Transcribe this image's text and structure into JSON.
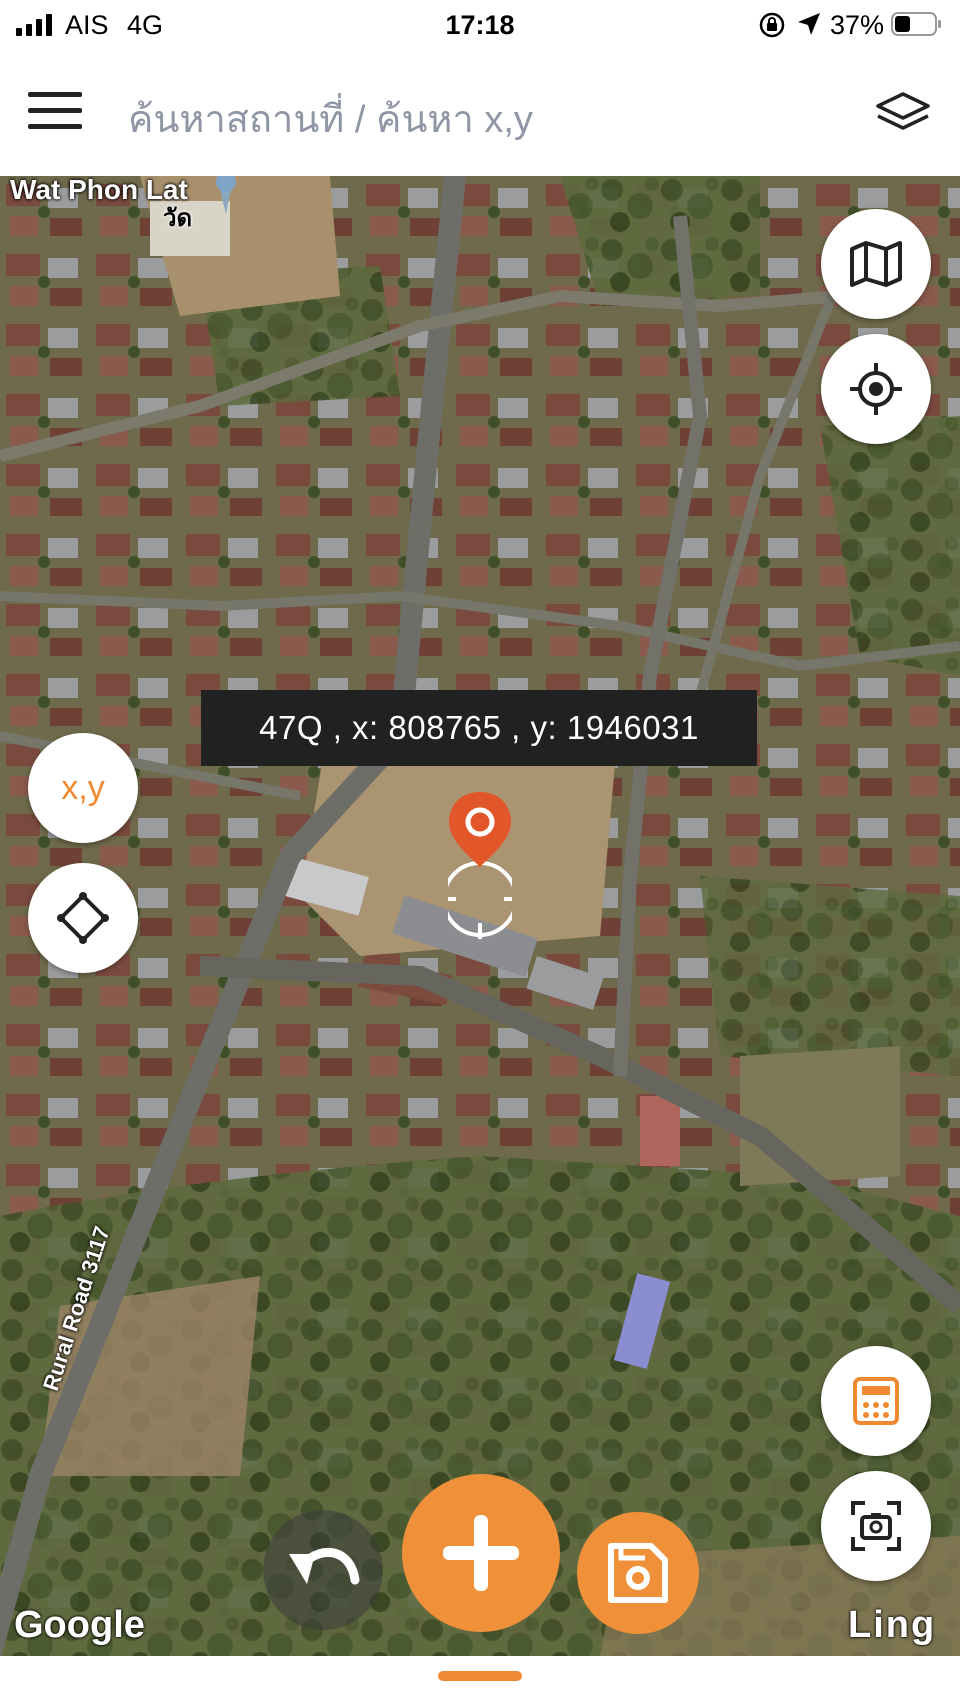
{
  "status_bar": {
    "carrier": "AIS",
    "network": "4G",
    "time": "17:18",
    "battery": "37%",
    "icons": [
      "signal-icon",
      "orientation-lock-icon",
      "location-arrow-icon",
      "battery-icon"
    ]
  },
  "header": {
    "title": "ค้นหาสถานที่ / ค้นหา x,y",
    "menu_icon": "hamburger-icon",
    "layers_icon": "layers-icon"
  },
  "map": {
    "coordinate_readout": "47Q , x: 808765 , y: 1946031",
    "xy_button_label": "x,y",
    "road_label": "Rural Road 3117",
    "place_label": "Wat Phon Lat",
    "place_label_thai": "วัด",
    "attribution": "Google",
    "corner_text": "Ling",
    "side_buttons": {
      "map_type_icon": "map-icon",
      "my_location_icon": "crosshair-location-icon",
      "shape_icon": "polygon-icon",
      "calculator_icon": "calculator-icon",
      "screenshot_icon": "screenshot-icon"
    }
  },
  "actions": {
    "undo_icon": "undo-icon",
    "add_icon": "plus-icon",
    "save_icon": "save-icon"
  },
  "colors": {
    "accent": "#f0913a",
    "pin": "#e2572a",
    "header_title": "#8f96a6"
  }
}
